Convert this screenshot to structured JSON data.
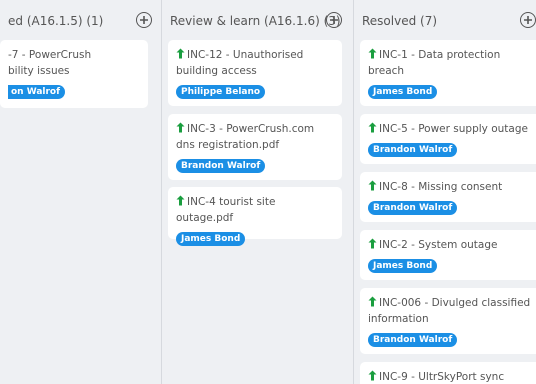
{
  "columns": [
    {
      "title": "ed (A16.1.5) (1)",
      "cards": [
        {
          "title": "-7 - PowerCrush",
          "title2": "bility issues",
          "assignee": "on Walrof"
        }
      ]
    },
    {
      "title": "Review & learn (A16.1.6) (3)",
      "cards": [
        {
          "title": "INC-12 - Unauthorised building access",
          "assignee": "Philippe Belano"
        },
        {
          "title": "INC-3 - PowerCrush.com dns registration.pdf",
          "assignee": "Brandon Walrof"
        },
        {
          "title": "INC-4 tourist site outage.pdf",
          "assignee": "James Bond"
        }
      ]
    },
    {
      "title": "Resolved (7)",
      "cards": [
        {
          "title": "INC-1 - Data protection breach",
          "assignee": "James Bond"
        },
        {
          "title": "INC-5 - Power supply outage",
          "assignee": "Brandon Walrof"
        },
        {
          "title": "INC-8 - Missing consent",
          "assignee": "Brandon Walrof"
        },
        {
          "title": "INC-2 - System outage",
          "assignee": "James Bond"
        },
        {
          "title": "INC-006 - Divulged classified information",
          "assignee": "Brandon Walrof"
        },
        {
          "title": "INC-9 - UltrSkyPort sync",
          "assignee": ""
        }
      ]
    }
  ],
  "colors": {
    "badge": "#1b8fe5",
    "priority_icon": "#1a9e3f",
    "background": "#eef0f3"
  },
  "icons": {
    "add": "plus-circle-icon",
    "priority": "arrow-up-icon"
  }
}
